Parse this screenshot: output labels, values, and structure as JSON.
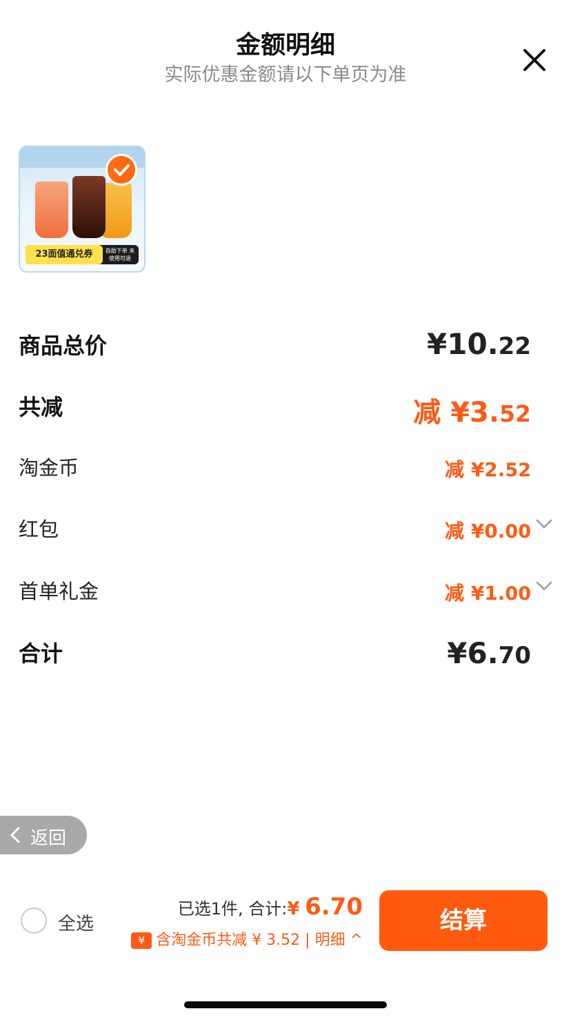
{
  "header": {
    "title": "金额明细",
    "subtitle": "实际优惠金额请以下单页为准"
  },
  "product": {
    "badge_text": "23面值通兑券",
    "badge_note": "自助下单 未使用可退"
  },
  "rows": {
    "total_price": {
      "label": "商品总价",
      "currency": "¥",
      "int": "10.",
      "cents": "22"
    },
    "total_discount": {
      "label": "共减",
      "prefix": "减",
      "currency": "¥",
      "int": "3.",
      "cents": "52"
    },
    "coins": {
      "label": "淘金币",
      "prefix": "减",
      "currency": "¥",
      "int": "2.",
      "cents": "52"
    },
    "red_packet": {
      "label": "红包",
      "prefix": "减",
      "currency": "¥",
      "int": "0.",
      "cents": "00"
    },
    "first_gift": {
      "label": "首单礼金",
      "prefix": "减",
      "currency": "¥",
      "int": "1.",
      "cents": "00"
    },
    "sum": {
      "label": "合计",
      "currency": "¥",
      "int": "6.",
      "cents": "70"
    }
  },
  "back": {
    "label": "返回"
  },
  "footer": {
    "select_all": "全选",
    "selected_text": "已选1件, 合计:",
    "currency": "¥",
    "amount": "6.70",
    "coin_badge": "¥",
    "coin_text": "含淘金币共减 ¥ 3.52 | 明细 ^",
    "checkout": "结算"
  },
  "colors": {
    "accent": "#ff5a14",
    "checkout_bg": "#ff5a0d"
  },
  "icons": [
    "close-icon",
    "check-icon",
    "chevron-down-icon",
    "chevron-left-icon"
  ]
}
